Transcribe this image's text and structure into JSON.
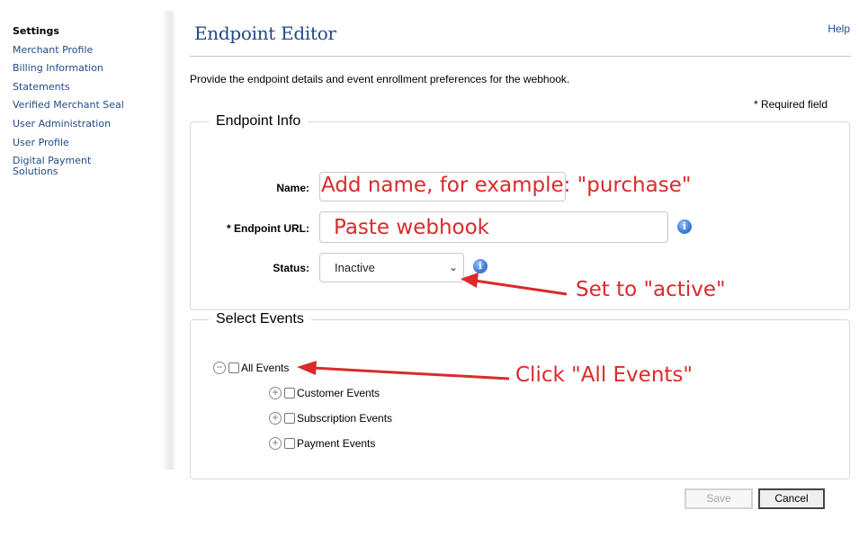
{
  "sidebar": {
    "title": "Settings",
    "items": [
      {
        "label": "Merchant Profile"
      },
      {
        "label": "Billing Information"
      },
      {
        "label": "Statements"
      },
      {
        "label": "Verified Merchant Seal"
      },
      {
        "label": "User Administration"
      },
      {
        "label": "User Profile"
      },
      {
        "label": "Digital Payment Solutions"
      }
    ]
  },
  "header": {
    "title": "Endpoint Editor",
    "help_label": "Help"
  },
  "intro_text": "Provide the endpoint details and event enrollment preferences for the webhook.",
  "required_note": "* Required field",
  "endpoint_info": {
    "legend": "Endpoint Info",
    "name_label": "Name:",
    "name_value": "",
    "url_label": "* Endpoint URL:",
    "url_value": "",
    "status_label": "Status:",
    "status_value": "Inactive"
  },
  "select_events": {
    "legend": "Select Events",
    "tree": [
      {
        "label": "All Events",
        "expanded": true,
        "checked": false
      },
      {
        "label": "Customer Events",
        "expanded": false,
        "checked": false
      },
      {
        "label": "Subscription Events",
        "expanded": false,
        "checked": false
      },
      {
        "label": "Payment Events",
        "expanded": false,
        "checked": false
      }
    ]
  },
  "buttons": {
    "save_label": "Save",
    "cancel_label": "Cancel",
    "save_disabled": true
  },
  "annotations": {
    "name_hint": "Add name, for example: \"purchase\"",
    "url_hint": "Paste webhook",
    "status_hint": "Set to \"active\"",
    "events_hint": "Click \"All Events\"",
    "color": "#d92b2b"
  },
  "colors": {
    "link": "#1f4a86",
    "annotation": "#d92b2b",
    "info_icon": "#3b7fe0"
  }
}
